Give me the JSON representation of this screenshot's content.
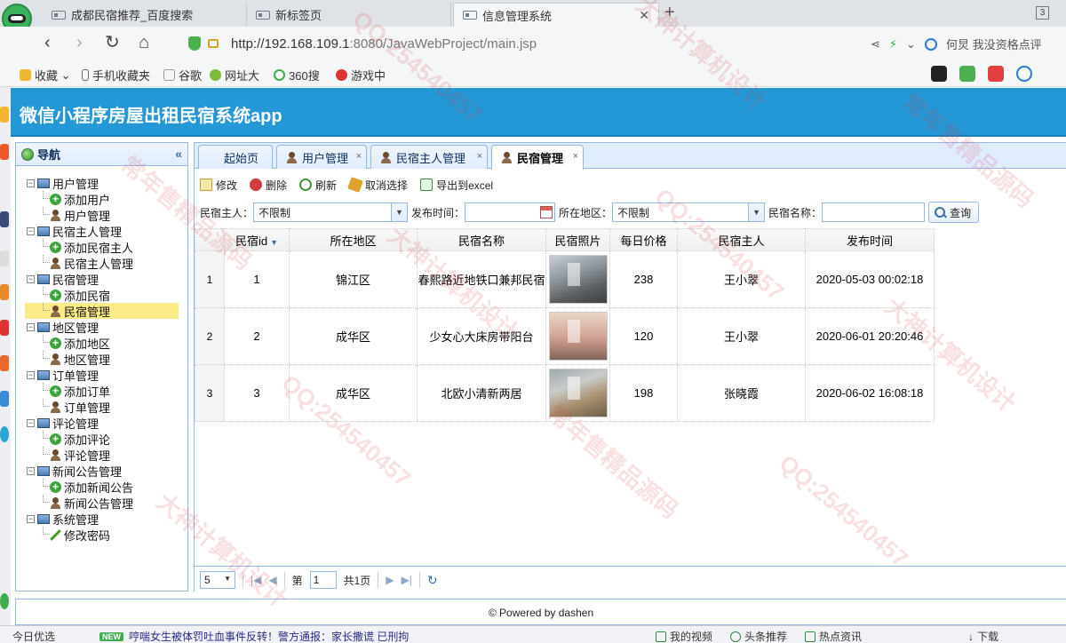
{
  "browser": {
    "tabs": [
      {
        "title": "成都民宿推荐_百度搜索",
        "active": false
      },
      {
        "title": "新标签页",
        "active": false
      },
      {
        "title": "信息管理系统",
        "active": true
      }
    ],
    "new_tab": "+",
    "tab_count": "3",
    "url_host": "http://192.168.109.1",
    "url_path": ":8080/JavaWebProject/main.jsp",
    "account_text": "何炅 我没资格点评",
    "bookmarks": [
      "收藏",
      "手机收藏夹",
      "谷歌",
      "网址大",
      "360搜",
      "游戏中"
    ]
  },
  "app": {
    "title": "微信小程序房屋出租民宿系统app"
  },
  "nav": {
    "title": "导航",
    "collapse": "«",
    "groups": [
      {
        "label": "用户管理",
        "children": [
          {
            "label": "添加用户",
            "icon": "add"
          },
          {
            "label": "用户管理",
            "icon": "user"
          }
        ]
      },
      {
        "label": "民宿主人管理",
        "children": [
          {
            "label": "添加民宿主人",
            "icon": "add"
          },
          {
            "label": "民宿主人管理",
            "icon": "user"
          }
        ]
      },
      {
        "label": "民宿管理",
        "children": [
          {
            "label": "添加民宿",
            "icon": "add"
          },
          {
            "label": "民宿管理",
            "icon": "user",
            "selected": true
          }
        ]
      },
      {
        "label": "地区管理",
        "children": [
          {
            "label": "添加地区",
            "icon": "add"
          },
          {
            "label": "地区管理",
            "icon": "user"
          }
        ]
      },
      {
        "label": "订单管理",
        "children": [
          {
            "label": "添加订单",
            "icon": "add"
          },
          {
            "label": "订单管理",
            "icon": "user"
          }
        ]
      },
      {
        "label": "评论管理",
        "children": [
          {
            "label": "添加评论",
            "icon": "add"
          },
          {
            "label": "评论管理",
            "icon": "user"
          }
        ]
      },
      {
        "label": "新闻公告管理",
        "children": [
          {
            "label": "添加新闻公告",
            "icon": "add"
          },
          {
            "label": "新闻公告管理",
            "icon": "user"
          }
        ]
      },
      {
        "label": "系统管理",
        "children": [
          {
            "label": "修改密码",
            "icon": "pen"
          }
        ]
      }
    ]
  },
  "tabs": [
    {
      "label": "起始页",
      "closable": false
    },
    {
      "label": "用户管理",
      "closable": true
    },
    {
      "label": "民宿主人管理",
      "closable": true
    },
    {
      "label": "民宿管理",
      "closable": true,
      "active": true
    }
  ],
  "toolbar": {
    "edit": "修改",
    "delete": "删除",
    "refresh": "刷新",
    "cancel_select": "取消选择",
    "export": "导出到excel"
  },
  "search": {
    "owner_label": "民宿主人：",
    "owner_value": "不限制",
    "date_label": "发布时间：",
    "date_value": "",
    "area_label": "所在地区：",
    "area_value": "不限制",
    "name_label": "民宿名称：",
    "name_value": "",
    "query": "查询"
  },
  "grid": {
    "columns": [
      "民宿id",
      "所在地区",
      "民宿名称",
      "民宿照片",
      "每日价格",
      "民宿主人",
      "发布时间"
    ],
    "rows": [
      {
        "rn": "1",
        "id": "1",
        "area": "锦江区",
        "name": "春熙路近地铁口兼邦民宿",
        "price": "238",
        "owner": "王小翠",
        "time": "2020-05-03 00:02:18"
      },
      {
        "rn": "2",
        "id": "2",
        "area": "成华区",
        "name": "少女心大床房带阳台",
        "price": "120",
        "owner": "王小翠",
        "time": "2020-06-01 20:20:46"
      },
      {
        "rn": "3",
        "id": "3",
        "area": "成华区",
        "name": "北欧小清新两居",
        "price": "198",
        "owner": "张晓霞",
        "time": "2020-06-02 16:08:18"
      }
    ]
  },
  "pager": {
    "page_size": "5",
    "page_prefix": "第",
    "page_num": "1",
    "page_total": "共1页"
  },
  "footer": "© Powered by dashen",
  "statusbar": {
    "left": "今日优选",
    "badge": "NEW",
    "news": "哼喘女生被体罚吐血事件反转！警方通报：家长撒谎 已刑拘",
    "video": "我的视频",
    "headline": "头条推荐",
    "hot": "热点资讯",
    "download": "下载"
  },
  "watermarks": [
    "QQ:254540457",
    "常年售精品源码",
    "大神计算机设计"
  ]
}
